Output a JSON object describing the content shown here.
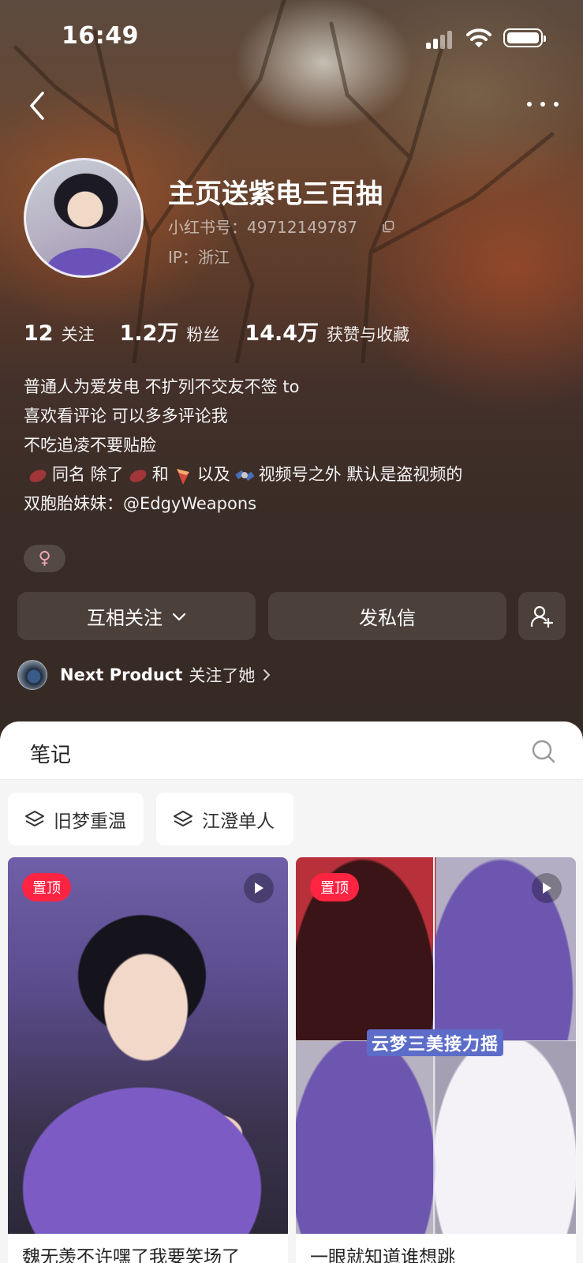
{
  "status_bar": {
    "time": "16:49"
  },
  "profile": {
    "nickname": "主页送紫电三百抽",
    "red_id": "小红书号：49712149787",
    "ip": "IP：浙江",
    "stats": [
      {
        "value": "12",
        "label": "关注"
      },
      {
        "value": "1.2万",
        "label": "粉丝"
      },
      {
        "value": "14.4万",
        "label": "获赞与收藏"
      }
    ],
    "bio": {
      "line1": "普通人为爱发电 不扩列不交友不签 to",
      "line2": "喜欢看评论 可以多多评论我",
      "line3": "不吃追凌不要贴脸",
      "line4_a": "同名 除了",
      "line4_b": "和",
      "line4_c": "以及",
      "line4_d": "视频号之外 默认是盗视频的",
      "line5_prefix": "双胞胎妹妹：",
      "line5_mention": "@EdgyWeapons"
    },
    "gender_symbol": "♀",
    "gender_color": "#f0a6b8"
  },
  "actions": {
    "follow_label": "互相关注",
    "message_label": "发私信"
  },
  "followed_by": {
    "name": "Next Product",
    "text": "关注了她"
  },
  "tabs": {
    "notes": "笔记"
  },
  "collections": [
    {
      "label": "旧梦重温"
    },
    {
      "label": "江澄单人"
    }
  ],
  "notes": [
    {
      "badge": "置顶",
      "title": "魏无羡不许嘿了我要笑场了",
      "is_video": true
    },
    {
      "badge": "置顶",
      "overlay": "云梦三美接力摇",
      "title": "一眼就知道谁想跳",
      "is_video": true
    }
  ],
  "colors": {
    "accent": "#ff2442",
    "mention": "#ffffff"
  }
}
